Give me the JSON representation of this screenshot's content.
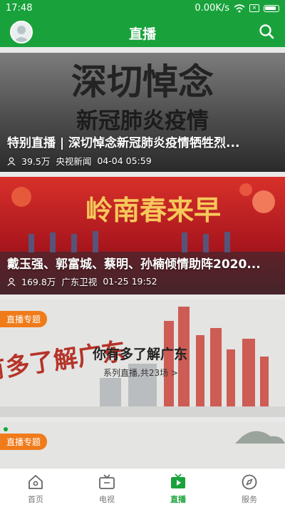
{
  "status": {
    "time": "17:48",
    "net_speed": "0.00K/s"
  },
  "header": {
    "title": "直播"
  },
  "feed": [
    {
      "title": "特别直播 | 深切悼念新冠肺炎疫情牺牲烈...",
      "poster_text_1": "深切悼念",
      "poster_text_2": "新冠肺炎疫情",
      "views": "39.5万",
      "source": "央视新闻",
      "time": "04-04 05:59"
    },
    {
      "title": "戴玉强、郭富城、蔡明、孙楠倾情助阵2020...",
      "poster_text": "岭南春来早",
      "views": "169.8万",
      "source": "广东卫视",
      "time": "01-25 19:52"
    },
    {
      "badge": "直播专题",
      "poster_text": "你有多了解广东",
      "title": "你有多了解广东",
      "subtitle": "系列直播,共23场 >"
    },
    {
      "badge": "直播专题"
    }
  ],
  "nav": [
    {
      "label": "首页",
      "icon": "home-icon"
    },
    {
      "label": "电视",
      "icon": "tv-icon"
    },
    {
      "label": "直播",
      "icon": "live-icon"
    },
    {
      "label": "服务",
      "icon": "compass-icon"
    }
  ],
  "colors": {
    "brand": "#19a23b",
    "badge": "#f07b1a"
  }
}
